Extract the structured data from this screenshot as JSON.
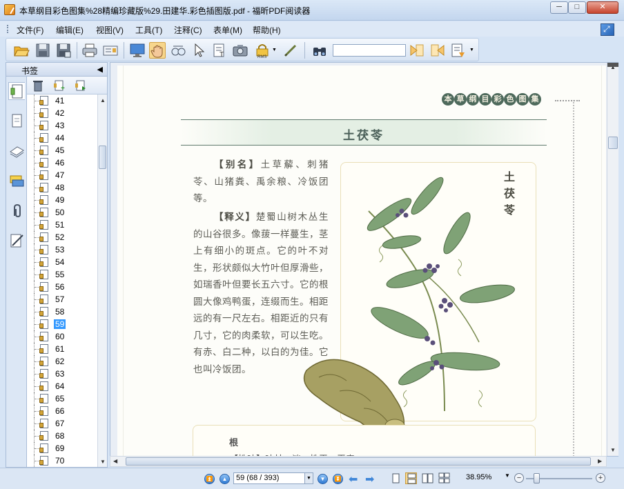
{
  "window": {
    "title": "本草纲目彩色图集%28精编珍藏版%29.田建华.彩色插图版.pdf - 福昕PDF阅读器",
    "minimize": "─",
    "maximize": "□",
    "close": "✕"
  },
  "menu": [
    {
      "label": "文件(F)"
    },
    {
      "label": "编辑(E)"
    },
    {
      "label": "视图(V)"
    },
    {
      "label": "工具(T)"
    },
    {
      "label": "注释(C)"
    },
    {
      "label": "表单(M)"
    },
    {
      "label": "帮助(H)"
    }
  ],
  "toolbar": {
    "search_value": ""
  },
  "sidebar": {
    "header": "书签",
    "collapse_glyph": "◀",
    "bookmarks": [
      "41",
      "42",
      "43",
      "44",
      "45",
      "46",
      "47",
      "48",
      "49",
      "50",
      "51",
      "52",
      "53",
      "54",
      "55",
      "56",
      "57",
      "58",
      "59",
      "60",
      "61",
      "62",
      "63",
      "64",
      "65",
      "66",
      "67",
      "68",
      "69",
      "70"
    ],
    "selected": "59"
  },
  "document": {
    "series_title": [
      "本",
      "草",
      "纲",
      "目",
      "彩",
      "色",
      "图",
      "集"
    ],
    "herb_name": "土茯苓",
    "alias_term": "【别名】",
    "alias_text": "土草薢、刺猪苓、山猪粪、禹余粮、冷饭团等。",
    "meaning_term": "【释义】",
    "meaning_text": "楚蜀山树木丛生的山谷很多。像菝一样蔓生，茎上有细小的斑点。它的叶不对生，形状颇似大竹叶但厚滑些，如瑞香叶但要长五六寸。它的根圆大像鸡鸭蛋，连缀而生。相距远的有一尺左右。相距近的只有几寸，它的肉柔软，可以生吃。有赤、白二种，以白的为佳。它也叫冷饭团。",
    "illustration_title": "土茯苓",
    "root_heading": "根",
    "root_text": "【性味】味甘、淡，性平，无毒。"
  },
  "statusbar": {
    "page_value": "59 (68 / 393)",
    "zoom": "38.95%"
  },
  "colors": {
    "selection": "#3399ff",
    "page_background": "#fdfdf9",
    "accent_green": "#4e6a5c"
  }
}
